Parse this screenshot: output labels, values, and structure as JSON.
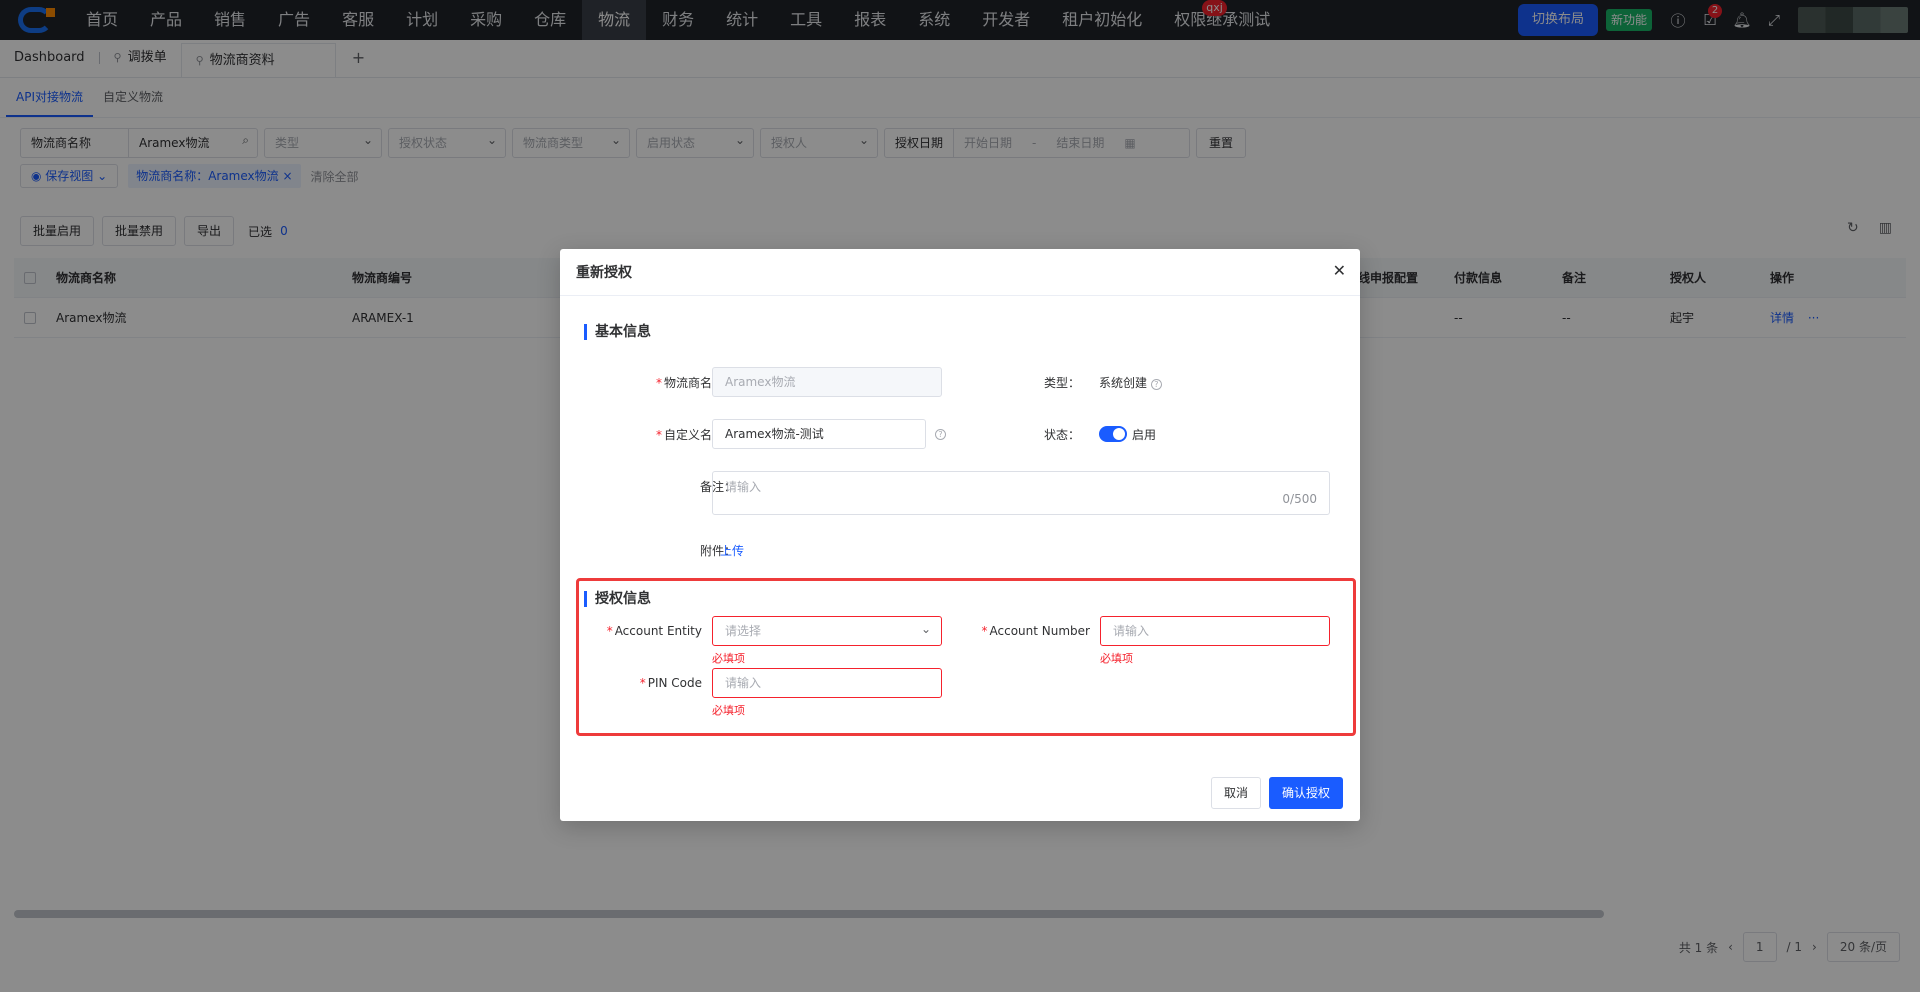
{
  "nav": {
    "items": [
      "首页",
      "产品",
      "销售",
      "广告",
      "客服",
      "计划",
      "采购",
      "仓库",
      "物流",
      "财务",
      "统计",
      "工具",
      "报表",
      "系统",
      "开发者",
      "租户初始化",
      "权限继承测试"
    ],
    "active": "物流",
    "badge_text": "qxj",
    "switch_layout": "切换布局",
    "new_feature": "新功能",
    "todo_count": "2"
  },
  "tabs": {
    "dashboard": "Dashboard",
    "tab1": "调拨单",
    "tab2": "物流商资料",
    "add": "+"
  },
  "subtabs": [
    "API对接物流",
    "自定义物流"
  ],
  "filters": {
    "name_field": "物流商名称",
    "name_value": "Aramex物流",
    "type": "类型",
    "auth_status": "授权状态",
    "carrier_type": "物流商类型",
    "enable_status": "启用状态",
    "authorizer": "授权人",
    "date_label": "授权日期",
    "start_date": "开始日期",
    "date_sep": "-",
    "end_date": "结束日期",
    "reset": "重置",
    "save_view": "保存视图",
    "chip": "物流商名称：Aramex物流",
    "clear_all": "清除全部"
  },
  "toolbar": {
    "batch_enable": "批量启用",
    "batch_disable": "批量禁用",
    "export": "导出",
    "selected_label": "已选",
    "selected_count": "0"
  },
  "table": {
    "headers": [
      "物流商名称",
      "物流商编号",
      "在线申报配置",
      "付款信息",
      "备注",
      "授权人",
      "操作"
    ],
    "rows": [
      {
        "name": "Aramex物流",
        "code": "ARAMEX-1",
        "online": "--",
        "payment": "--",
        "remark": "--",
        "authorizer": "起宇",
        "action": "详情",
        "more": "···"
      }
    ]
  },
  "pager": {
    "total": "共 1 条",
    "prev": "‹",
    "page": "1",
    "sep": "/ 1",
    "next": "›",
    "size": "20 条/页"
  },
  "modal": {
    "title": "重新授权",
    "basic_section": "基本信息",
    "carrier_name_label": "物流商名称：",
    "carrier_name_value": "Aramex物流",
    "type_label": "类型：",
    "type_value": "系统创建",
    "custom_name_label": "自定义名称：",
    "custom_name_value": "Aramex物流-测试",
    "status_label": "状态：",
    "status_value": "启用",
    "remark_label": "备注：",
    "remark_placeholder": "请输入",
    "remark_counter": "0/500",
    "attach_label": "附件：",
    "upload": "上传",
    "auth_section": "授权信息",
    "account_entity_label": "Account Entity",
    "account_entity_placeholder": "请选择",
    "account_number_label": "Account Number",
    "account_number_placeholder": "请输入",
    "pin_label": "PIN Code",
    "pin_placeholder": "请输入",
    "required_msg": "必填项",
    "cancel": "取消",
    "confirm": "确认授权"
  }
}
